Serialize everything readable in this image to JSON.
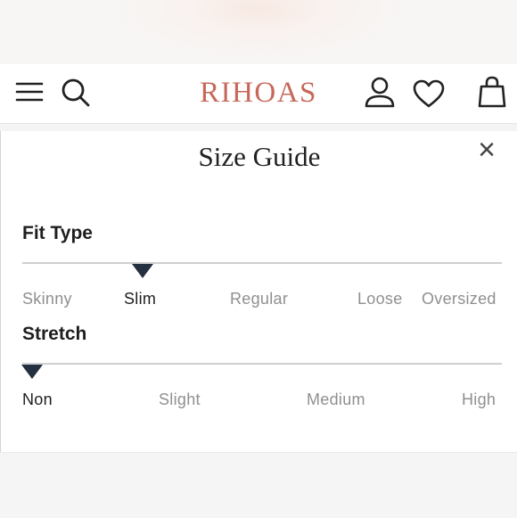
{
  "header": {
    "brand": "RIHOAS",
    "brand_color": "#c7685a",
    "icons": [
      "menu-icon",
      "search-icon",
      "account-icon",
      "wishlist-heart-icon",
      "shopping-bag-icon"
    ]
  },
  "size_guide": {
    "title": "Size Guide",
    "close_glyph": "×",
    "fit_type": {
      "label": "Fit Type",
      "options": [
        "Skinny",
        "Slim",
        "Regular",
        "Loose",
        "Oversized"
      ],
      "selected": "Slim"
    },
    "stretch": {
      "label": "Stretch",
      "options": [
        "Non",
        "Slight",
        "Medium",
        "High"
      ],
      "selected": "Non"
    }
  },
  "colors": {
    "marker": "#243040",
    "track": "#cfcfcf",
    "option_text": "#8f8f8f"
  }
}
